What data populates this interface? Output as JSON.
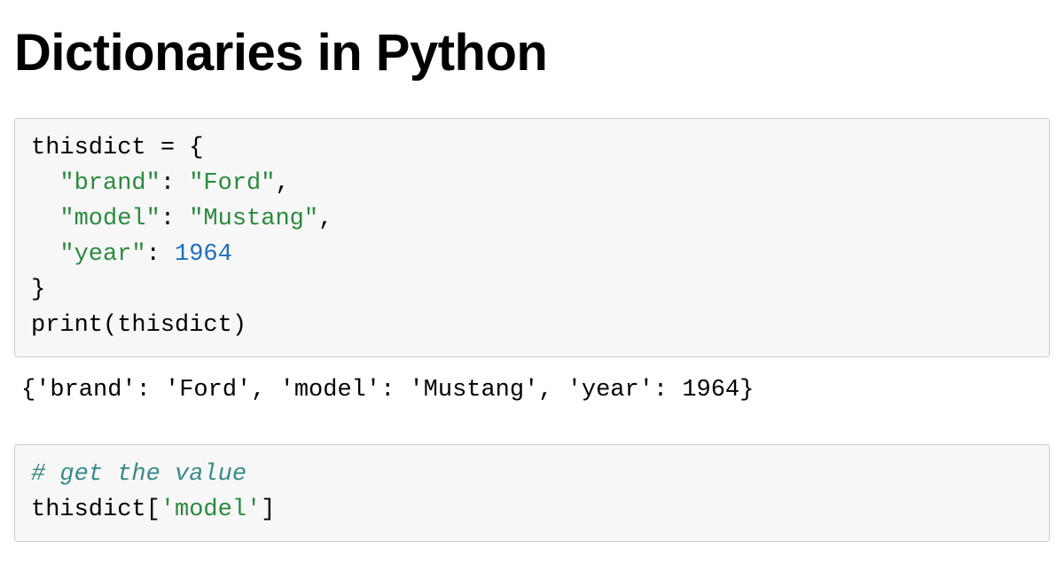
{
  "title": "Dictionaries in Python",
  "cell1": {
    "line1a": "thisdict = {",
    "line2_indent": "  ",
    "key_brand": "\"brand\"",
    "colon": ": ",
    "val_brand": "\"Ford\"",
    "comma": ",",
    "key_model": "\"model\"",
    "val_model": "\"Mustang\"",
    "key_year": "\"year\"",
    "val_year": "1964",
    "line6": "}",
    "line7": "print(thisdict)"
  },
  "output1": "{'brand': 'Ford', 'model': 'Mustang', 'year': 1964}",
  "cell2": {
    "comment": "# get the value",
    "line2a": "thisdict[",
    "line2b": "'model'",
    "line2c": "]"
  }
}
